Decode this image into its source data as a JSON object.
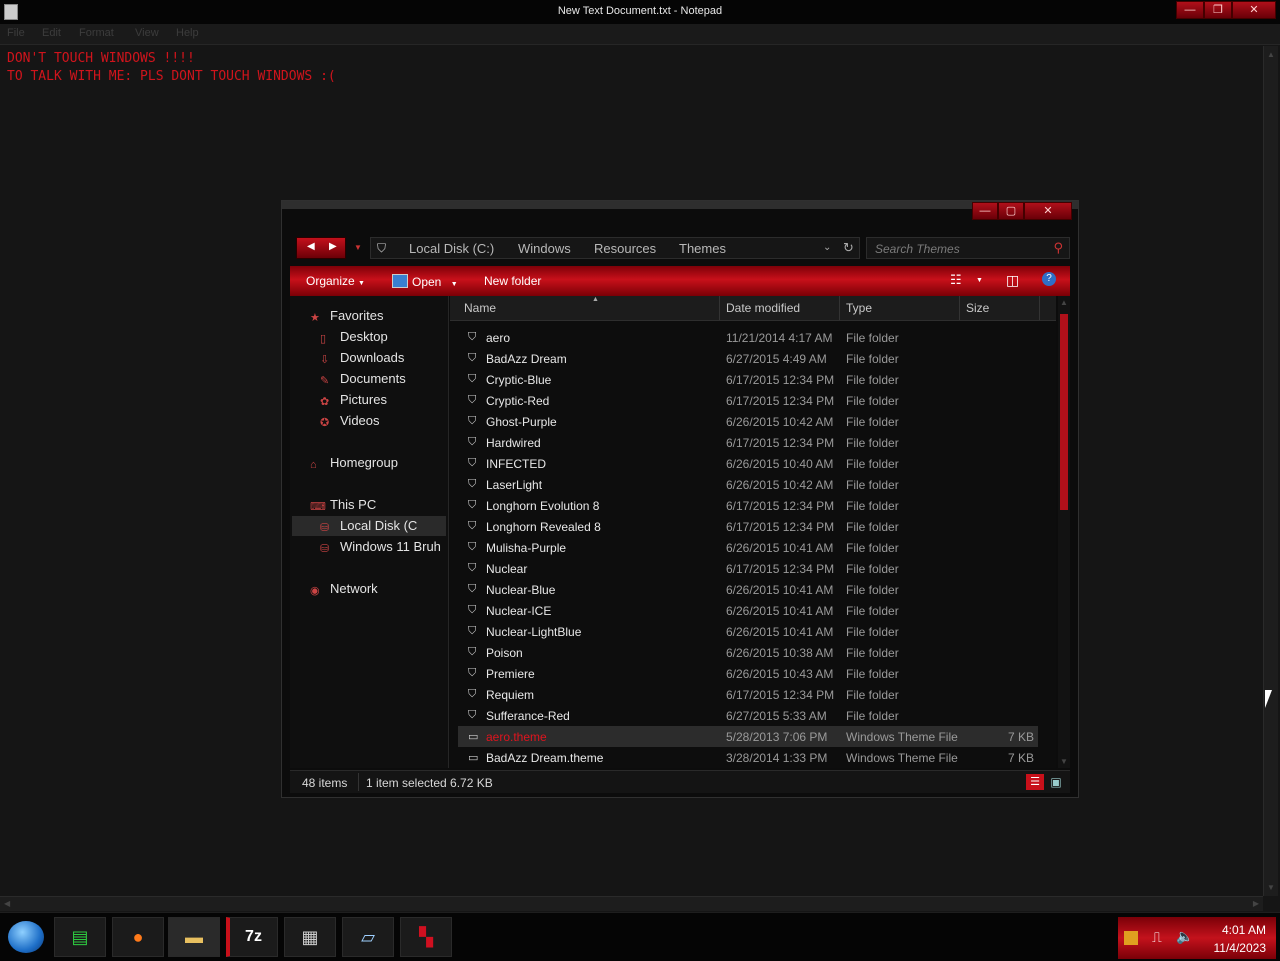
{
  "notepad": {
    "title": "New Text Document.txt - Notepad",
    "menu": [
      "File",
      "Edit",
      "Format",
      "View",
      "Help"
    ],
    "lines": [
      "DON'T TOUCH WINDOWS !!!!",
      "TO TALK WITH ME: PLS DONT TOUCH WINDOWS :("
    ]
  },
  "explorer": {
    "breadcrumb": [
      "Local Disk (C:)",
      "Windows",
      "Resources",
      "Themes"
    ],
    "search_placeholder": "Search Themes",
    "toolbar": {
      "organize": "Organize",
      "open": "Open",
      "new_folder": "New folder"
    },
    "nav": {
      "favorites": "Favorites",
      "desktop": "Desktop",
      "downloads": "Downloads",
      "documents": "Documents",
      "pictures": "Pictures",
      "videos": "Videos",
      "homegroup": "Homegroup",
      "this_pc": "This PC",
      "local_disk": "Local Disk (C",
      "windows11": "Windows 11 Bruh",
      "network": "Network"
    },
    "columns": {
      "name": "Name",
      "date": "Date modified",
      "type": "Type",
      "size": "Size"
    },
    "files": [
      {
        "name": "aero",
        "date": "11/21/2014 4:17 AM",
        "type": "File folder",
        "size": ""
      },
      {
        "name": "BadAzz Dream",
        "date": "6/27/2015 4:49 AM",
        "type": "File folder",
        "size": ""
      },
      {
        "name": "Cryptic-Blue",
        "date": "6/17/2015 12:34 PM",
        "type": "File folder",
        "size": ""
      },
      {
        "name": "Cryptic-Red",
        "date": "6/17/2015 12:34 PM",
        "type": "File folder",
        "size": ""
      },
      {
        "name": "Ghost-Purple",
        "date": "6/26/2015 10:42 AM",
        "type": "File folder",
        "size": ""
      },
      {
        "name": "Hardwired",
        "date": "6/17/2015 12:34 PM",
        "type": "File folder",
        "size": ""
      },
      {
        "name": "INFECTED",
        "date": "6/26/2015 10:40 AM",
        "type": "File folder",
        "size": ""
      },
      {
        "name": "LaserLight",
        "date": "6/26/2015 10:42 AM",
        "type": "File folder",
        "size": ""
      },
      {
        "name": "Longhorn Evolution 8",
        "date": "6/17/2015 12:34 PM",
        "type": "File folder",
        "size": ""
      },
      {
        "name": "Longhorn Revealed 8",
        "date": "6/17/2015 12:34 PM",
        "type": "File folder",
        "size": ""
      },
      {
        "name": "Mulisha-Purple",
        "date": "6/26/2015 10:41 AM",
        "type": "File folder",
        "size": ""
      },
      {
        "name": "Nuclear",
        "date": "6/17/2015 12:34 PM",
        "type": "File folder",
        "size": ""
      },
      {
        "name": "Nuclear-Blue",
        "date": "6/26/2015 10:41 AM",
        "type": "File folder",
        "size": ""
      },
      {
        "name": "Nuclear-ICE",
        "date": "6/26/2015 10:41 AM",
        "type": "File folder",
        "size": ""
      },
      {
        "name": "Nuclear-LightBlue",
        "date": "6/26/2015 10:41 AM",
        "type": "File folder",
        "size": ""
      },
      {
        "name": "Poison",
        "date": "6/26/2015 10:38 AM",
        "type": "File folder",
        "size": ""
      },
      {
        "name": "Premiere",
        "date": "6/26/2015 10:43 AM",
        "type": "File folder",
        "size": ""
      },
      {
        "name": "Requiem",
        "date": "6/17/2015 12:34 PM",
        "type": "File folder",
        "size": ""
      },
      {
        "name": "Sufferance-Red",
        "date": "6/27/2015 5:33 AM",
        "type": "File folder",
        "size": ""
      },
      {
        "name": "aero.theme",
        "date": "5/28/2013 7:06 PM",
        "type": "Windows Theme File",
        "size": "7 KB",
        "selected": true
      },
      {
        "name": "BadAzz Dream.theme",
        "date": "3/28/2014 1:33 PM",
        "type": "Windows Theme File",
        "size": "7 KB"
      }
    ],
    "status": {
      "count": "48 items",
      "selection": "1 item selected  6.72 KB"
    }
  },
  "taskbar": {
    "time": "4:01 AM",
    "date": "11/4/2023"
  },
  "colors": {
    "accent": "#c8101a",
    "selected_text": "#e0141e"
  }
}
